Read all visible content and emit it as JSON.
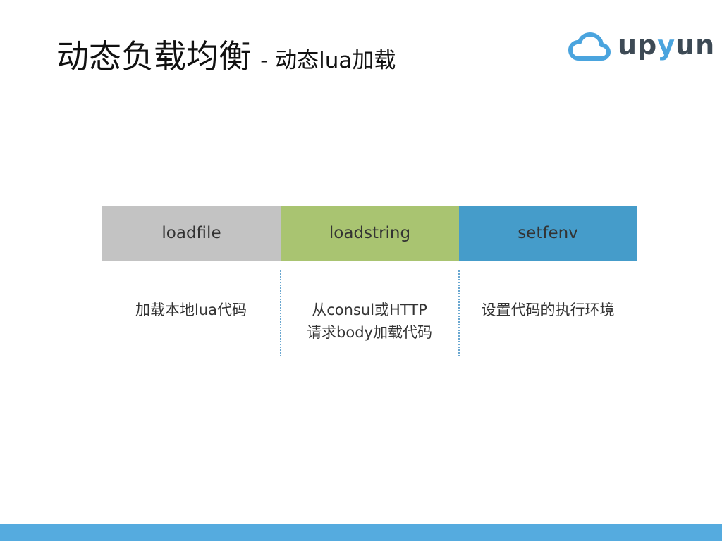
{
  "slide": {
    "title": "动态负载均衡",
    "subtitle": "- 动态lua加载"
  },
  "logo": {
    "icon": "cloud-icon",
    "text_part1": "up",
    "text_part2": "y",
    "text_part3": "un",
    "brand_color": "#4aa4de",
    "text_color": "#3d4a55"
  },
  "stages": [
    {
      "label": "loadfile",
      "color": "#c3c3c3",
      "description": [
        "加载本地lua代码"
      ]
    },
    {
      "label": "loadstring",
      "color": "#a9c471",
      "description": [
        "从consul或HTTP",
        "请求body加载代码"
      ]
    },
    {
      "label": "setfenv",
      "color": "#459cca",
      "description": [
        "设置代码的执行环境"
      ]
    }
  ],
  "footer": {
    "color": "#55abdf"
  }
}
